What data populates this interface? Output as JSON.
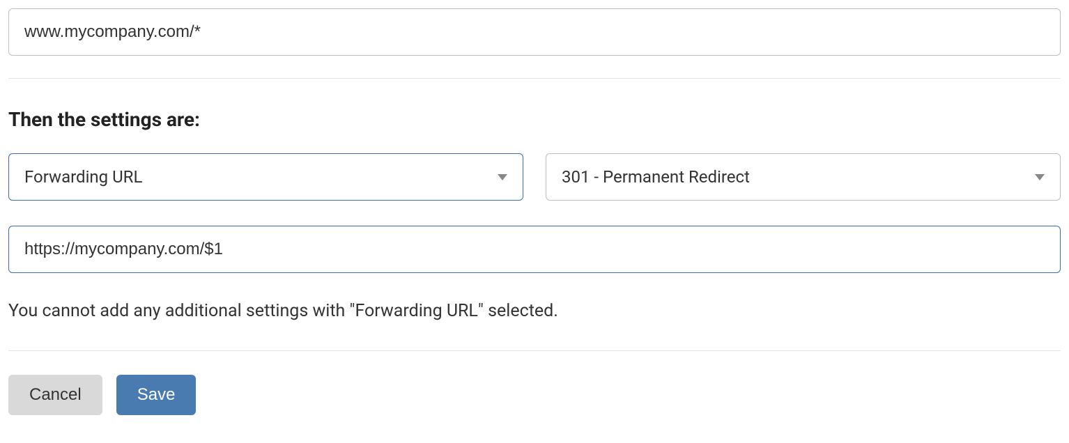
{
  "url_pattern": {
    "value": "www.mycompany.com/*"
  },
  "section": {
    "heading": "Then the settings are:"
  },
  "setting_select": {
    "label": "Forwarding URL"
  },
  "redirect_select": {
    "label": "301 - Permanent Redirect"
  },
  "destination": {
    "value": "https://mycompany.com/$1"
  },
  "info": {
    "text": "You cannot add any additional settings with \"Forwarding URL\" selected."
  },
  "buttons": {
    "cancel_label": "Cancel",
    "save_label": "Save"
  }
}
